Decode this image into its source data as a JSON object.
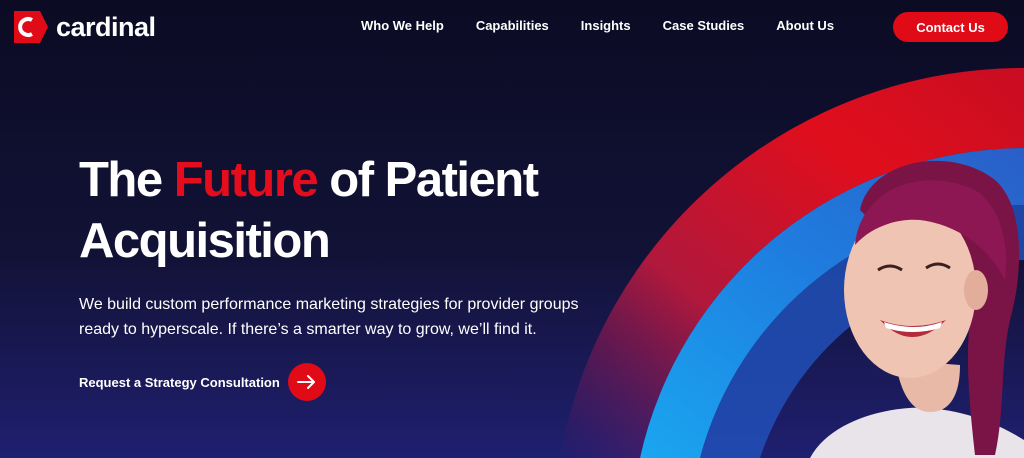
{
  "brand": {
    "name": "cardinal",
    "accent_color": "#e10a17",
    "background_color": "#10102f"
  },
  "nav": {
    "items": [
      {
        "label": "Who We Help"
      },
      {
        "label": "Capabilities"
      },
      {
        "label": "Insights"
      },
      {
        "label": "Case Studies"
      },
      {
        "label": "About Us"
      }
    ],
    "contact_label": "Contact Us"
  },
  "hero": {
    "title_part1": "The ",
    "title_accent": "Future",
    "title_part2": " of Patient Acquisition",
    "subtitle": "We build custom performance marketing strategies for provider groups ready to hyperscale. If there’s a smarter way to grow, we’ll find it.",
    "cta_label": "Request a Strategy Consultation",
    "cta_icon": "arrow-right-icon"
  },
  "imagery": {
    "description_icon": "smiling-woman-photo"
  }
}
